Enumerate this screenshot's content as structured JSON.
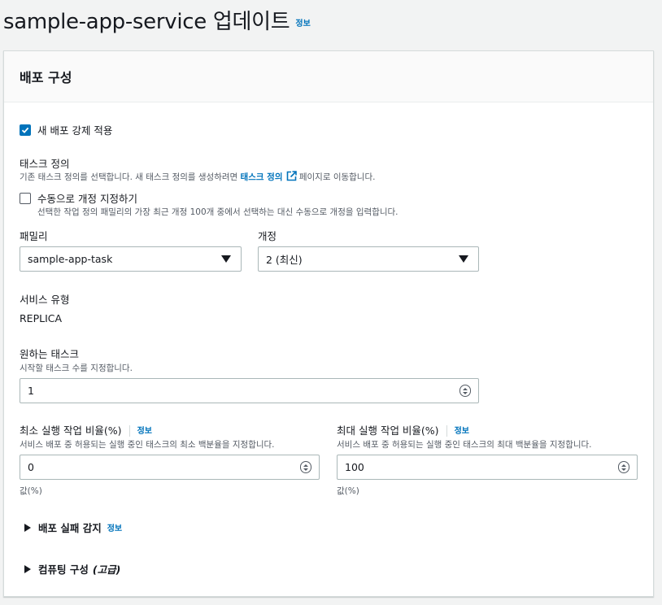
{
  "header": {
    "title": "sample-app-service 업데이트",
    "info": "정보"
  },
  "panel": {
    "title": "배포 구성"
  },
  "force_deploy": {
    "label": "새 배포 강제 적용",
    "checked": true
  },
  "task_def": {
    "label": "태스크 정의",
    "desc_before": "기존 태스크 정의를 선택합니다. 새 태스크 정의를 생성하려면 ",
    "desc_link": "태스크 정의",
    "desc_after": " 페이지로 이동합니다.",
    "manual_label": "수동으로 개정 지정하기",
    "manual_checked": false,
    "manual_desc": "선택한 작업 정의 패밀리의 가장 최근 개정 100개 중에서 선택하는 대신 수동으로 개정을 입력합니다."
  },
  "family": {
    "label": "패밀리",
    "value": "sample-app-task"
  },
  "revision": {
    "label": "개정",
    "value": "2 (최신)"
  },
  "service_type": {
    "label": "서비스 유형",
    "value": "REPLICA"
  },
  "desired_tasks": {
    "label": "원하는 태스크",
    "desc": "시작할 태스크 수를 지정합니다.",
    "value": "1"
  },
  "min_percent": {
    "label": "최소 실행 작업 비율(%)",
    "info": "정보",
    "desc": "서비스 배포 중 허용되는 실행 중인 태스크의 최소 백분율을 지정합니다.",
    "value": "0",
    "unit": "값(%)"
  },
  "max_percent": {
    "label": "최대 실행 작업 비율(%)",
    "info": "정보",
    "desc": "서비스 배포 중 허용되는 실행 중인 태스크의 최대 백분율을 지정합니다.",
    "value": "100",
    "unit": "값(%)"
  },
  "failure_detection": {
    "label": "배포 실패 감지",
    "info": "정보"
  },
  "compute_config": {
    "label": "컴퓨팅 구성",
    "advanced": "(고급)"
  },
  "colors": {
    "accent": "#0073bb",
    "text": "#16191f",
    "muted": "#545b64",
    "border": "#aab7b8"
  }
}
